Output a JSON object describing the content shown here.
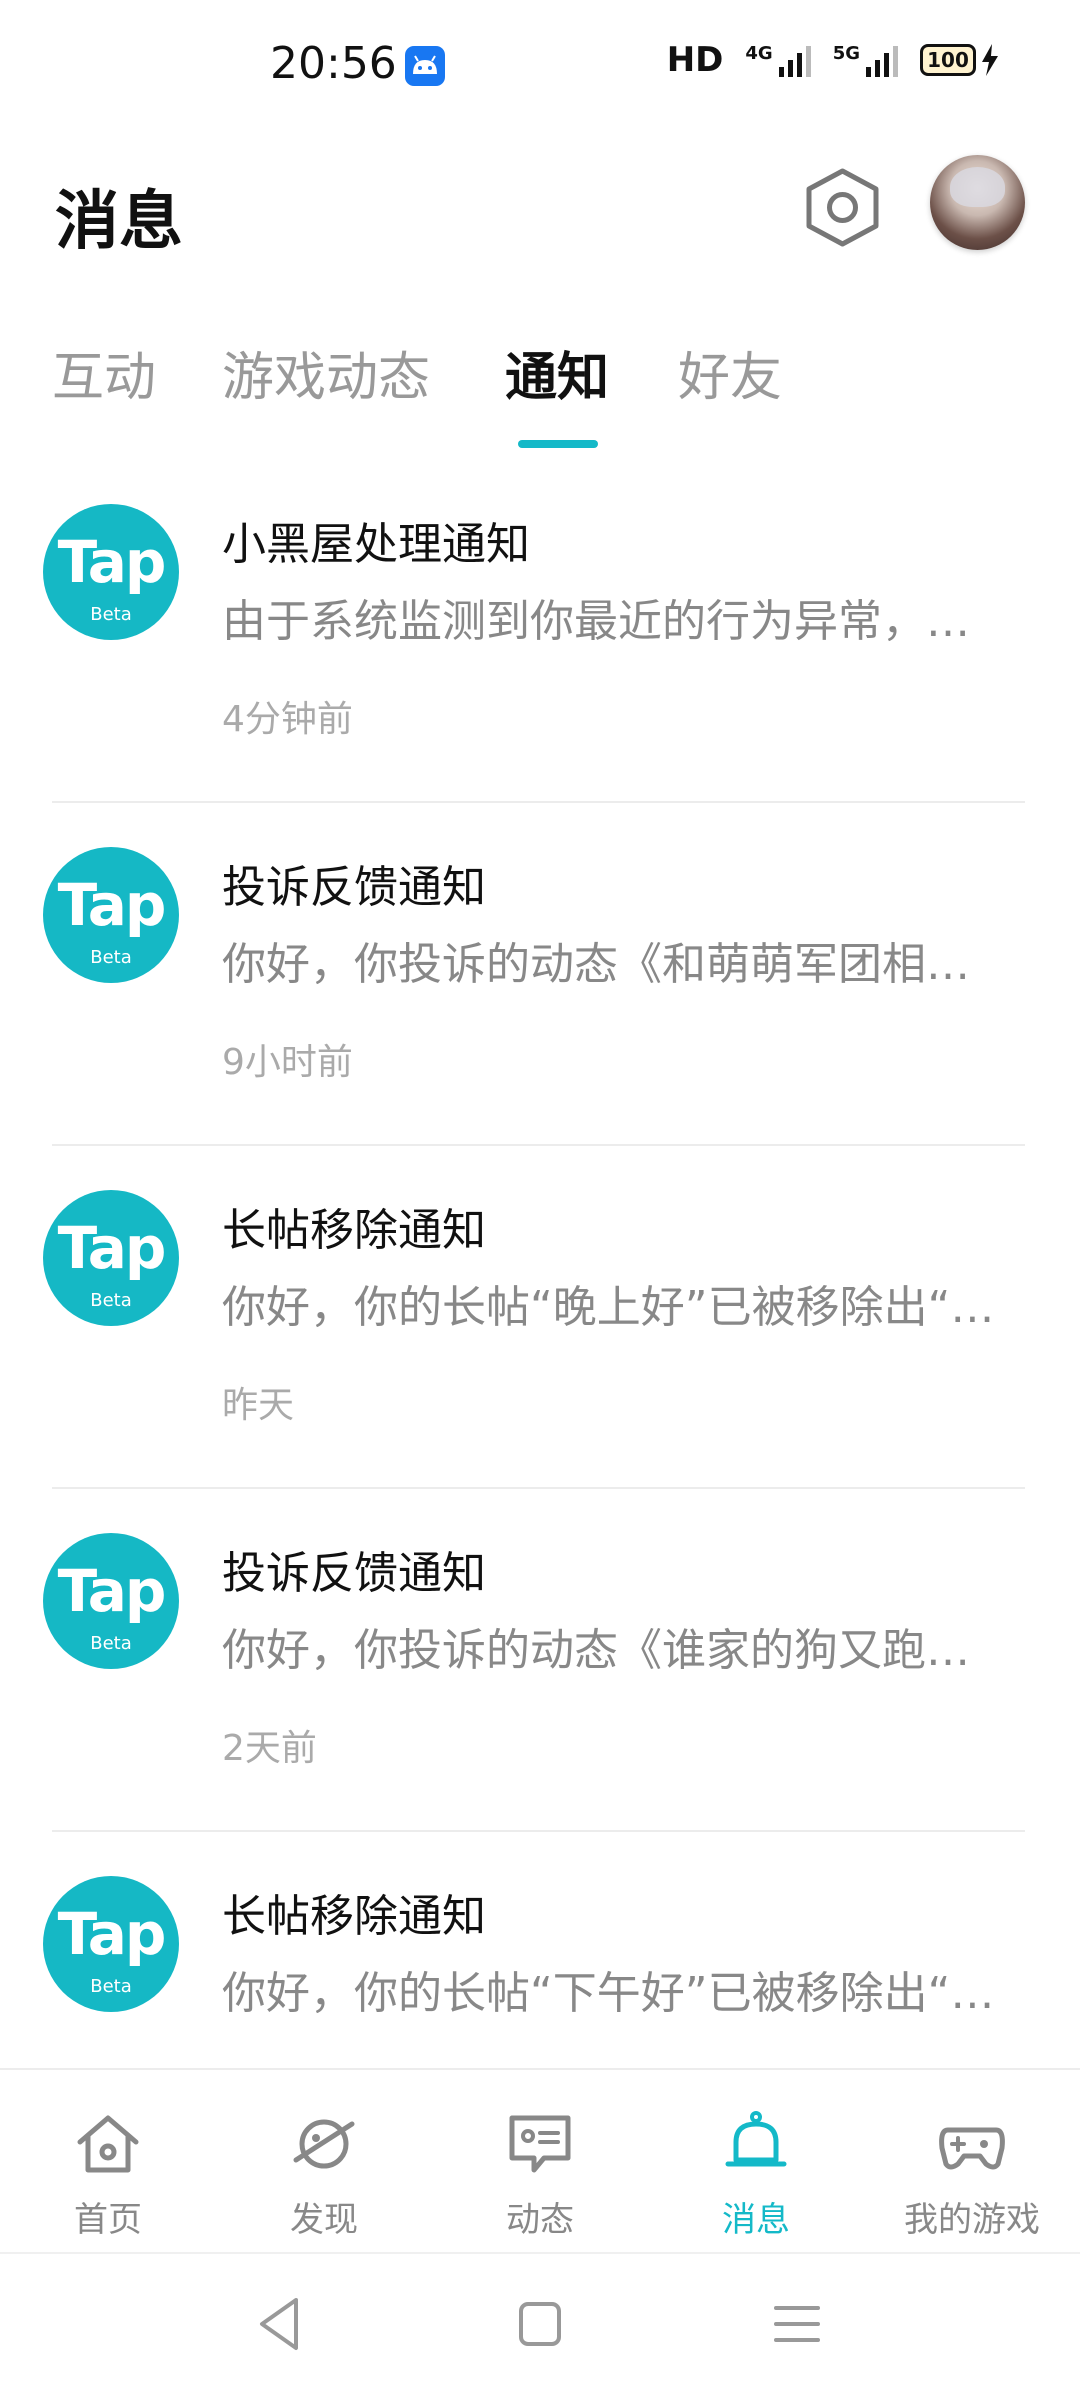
{
  "status_bar": {
    "time": "20:56",
    "hd_label": "HD",
    "net1_label": "4G",
    "net2_label": "5G",
    "battery": "100"
  },
  "header": {
    "title": "消息"
  },
  "tabs": [
    {
      "label": "互动",
      "active": false
    },
    {
      "label": "游戏动态",
      "active": false
    },
    {
      "label": "通知",
      "active": true
    },
    {
      "label": "好友",
      "active": false
    }
  ],
  "notifications": [
    {
      "title": "小黑屋处理通知",
      "body": "由于系统监测到你最近的行为异常，…",
      "time": "4分钟前"
    },
    {
      "title": "投诉反馈通知",
      "body": "你好，你投诉的动态《和萌萌军团相…",
      "time": "9小时前"
    },
    {
      "title": "长帖移除通知",
      "body": "你好，你的长帖“晚上好”已被移除出“…",
      "time": "昨天"
    },
    {
      "title": "投诉反馈通知",
      "body": "你好，你投诉的动态《谁家的狗又跑…",
      "time": "2天前"
    },
    {
      "title": "长帖移除通知",
      "body": "你好，你的长帖“下午好”已被移除出“…",
      "time": ""
    }
  ],
  "logo": {
    "tap": "Tap",
    "beta": "Beta"
  },
  "bottom_nav": [
    {
      "label": "首页",
      "icon": "home-icon",
      "active": false
    },
    {
      "label": "发现",
      "icon": "planet-icon",
      "active": false
    },
    {
      "label": "动态",
      "icon": "feed-icon",
      "active": false
    },
    {
      "label": "消息",
      "icon": "bell-icon",
      "active": true
    },
    {
      "label": "我的游戏",
      "icon": "gamepad-icon",
      "active": false
    }
  ],
  "colors": {
    "accent": "#14b9c8",
    "logo_bg": "#15b8c5"
  }
}
